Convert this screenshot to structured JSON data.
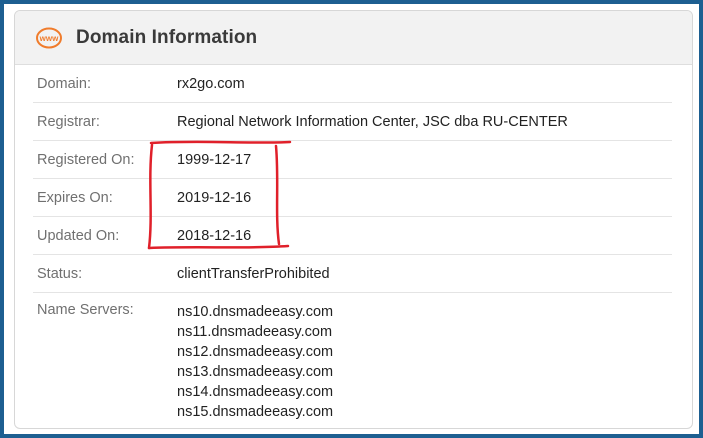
{
  "card": {
    "icon": "www-icon",
    "icon_text": "www",
    "title": "Domain Information"
  },
  "rows": [
    {
      "label": "Domain:",
      "value": "rx2go.com"
    },
    {
      "label": "Registrar:",
      "value": "Regional Network Information Center, JSC dba RU-CENTER"
    },
    {
      "label": "Registered On:",
      "value": "1999-12-17"
    },
    {
      "label": "Expires On:",
      "value": "2019-12-16"
    },
    {
      "label": "Updated On:",
      "value": "2018-12-16"
    },
    {
      "label": "Status:",
      "value": "clientTransferProhibited"
    }
  ],
  "name_servers": {
    "label": "Name Servers:",
    "values": [
      "ns10.dnsmadeeasy.com",
      "ns11.dnsmadeeasy.com",
      "ns12.dnsmadeeasy.com",
      "ns13.dnsmadeeasy.com",
      "ns14.dnsmadeeasy.com",
      "ns15.dnsmadeeasy.com"
    ]
  },
  "colors": {
    "background": "#1d5f91",
    "icon": "#f07c2c",
    "annotation": "#e0202a"
  }
}
